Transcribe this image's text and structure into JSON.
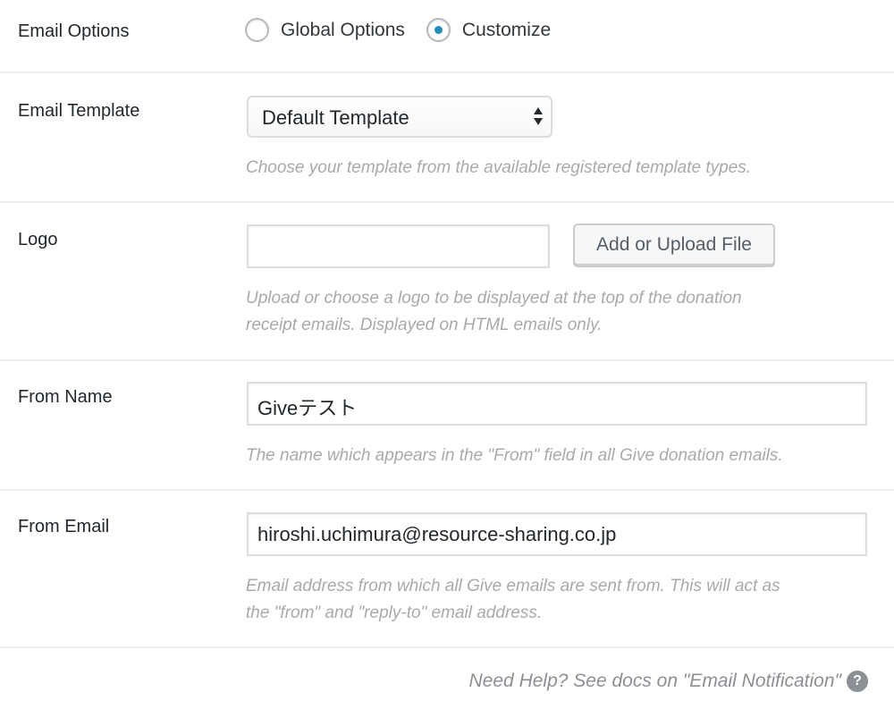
{
  "email_options": {
    "label": "Email Options",
    "options": [
      {
        "label": "Global Options",
        "checked": false
      },
      {
        "label": "Customize",
        "checked": true
      }
    ]
  },
  "email_template": {
    "label": "Email Template",
    "selected": "Default Template",
    "description": "Choose your template from the available registered template types."
  },
  "logo": {
    "label": "Logo",
    "value": "",
    "button_label": "Add or Upload File",
    "description_line1": "Upload or choose a logo to be displayed at the top of the donation",
    "description_line2": "receipt emails. Displayed on HTML emails only."
  },
  "from_name": {
    "label": "From Name",
    "value": "Giveテスト",
    "description": "The name which appears in the \"From\" field in all Give donation emails."
  },
  "from_email": {
    "label": "From Email",
    "value": "hiroshi.uchimura@resource-sharing.co.jp",
    "description_line1": "Email address from which all Give emails are sent from. This will act as",
    "description_line2": "the \"from\" and \"reply-to\" email address."
  },
  "help": {
    "text": "Need Help? See docs on \"Email Notification\"",
    "icon": "question-circle-icon",
    "icon_glyph": "?"
  },
  "colors": {
    "accent": "#1e8cbe",
    "border": "#ececec",
    "description": "#a7aaad"
  }
}
